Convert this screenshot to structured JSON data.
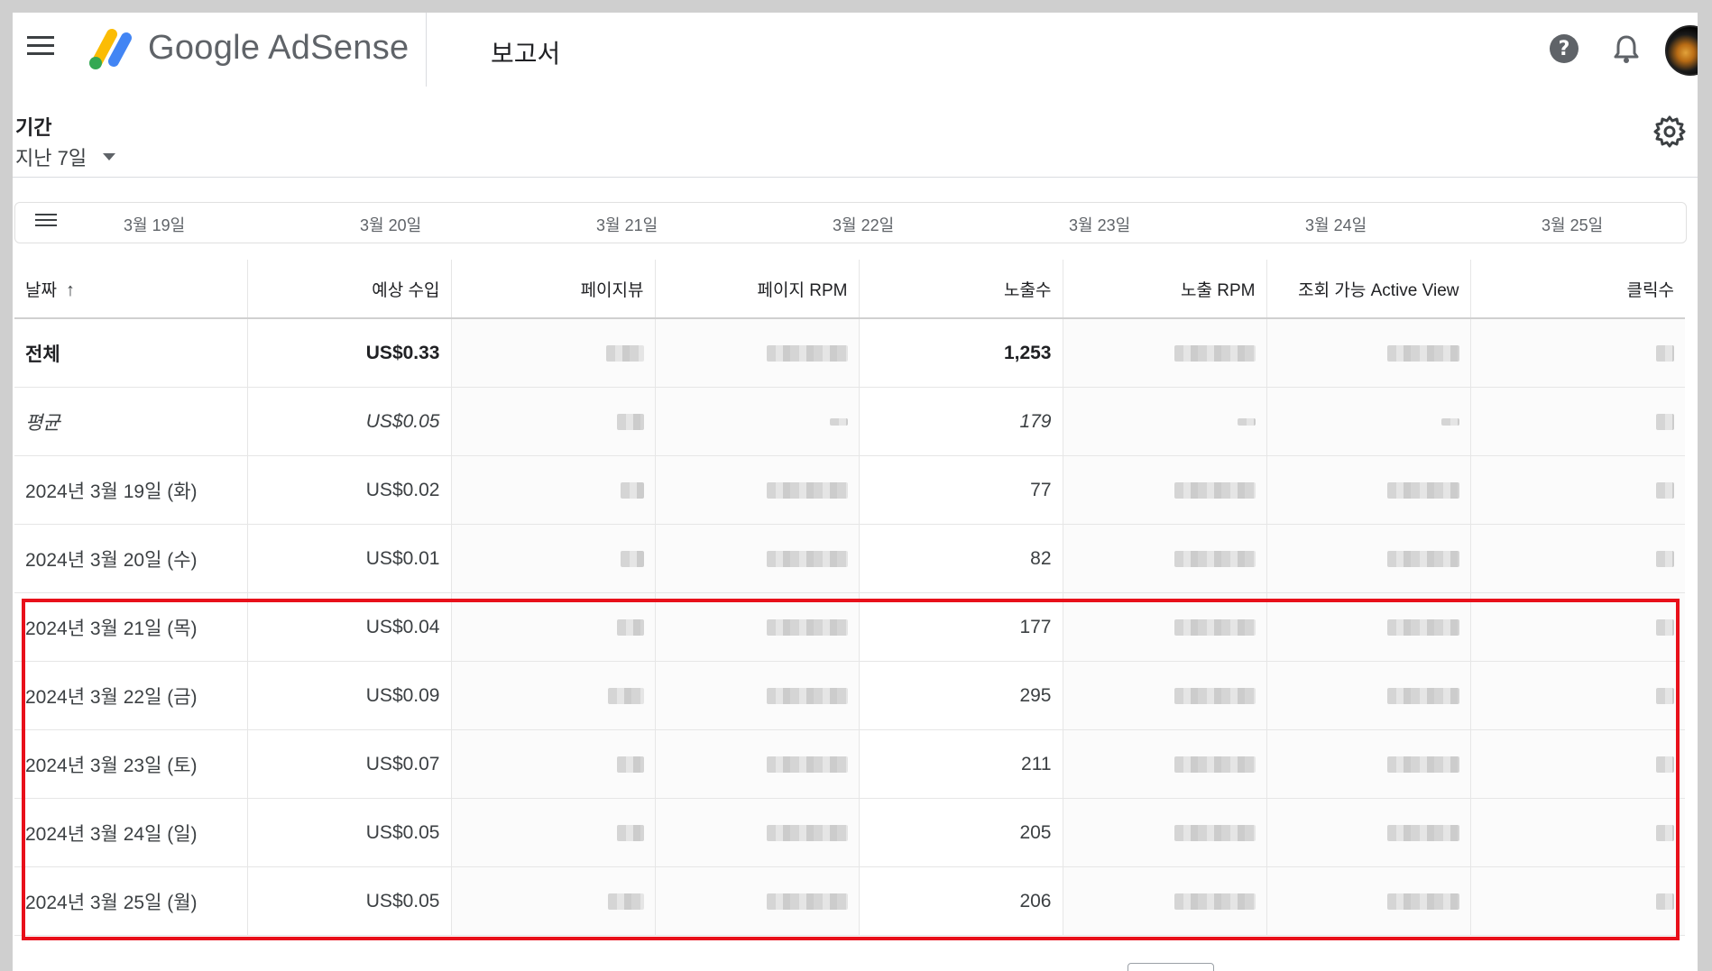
{
  "app": {
    "product_name": "Google AdSense",
    "page_title": "보고서"
  },
  "filter": {
    "period_label": "기간",
    "period_value": "지난 7일"
  },
  "timeline": {
    "dates": [
      "3월 19일",
      "3월 20일",
      "3월 21일",
      "3월 22일",
      "3월 23일",
      "3월 24일",
      "3월 25일"
    ]
  },
  "table": {
    "columns": [
      "날짜",
      "예상 수입",
      "페이지뷰",
      "페이지 RPM",
      "노출수",
      "노출 RPM",
      "조회 가능 Active View",
      "클릭수"
    ],
    "sort_indicator": "↑",
    "total": {
      "date": "전체",
      "earnings": "US$0.33",
      "impressions": "1,253"
    },
    "average": {
      "date": "평균",
      "earnings": "US$0.05",
      "impressions": "179"
    },
    "rows": [
      {
        "date": "2024년 3월 19일 (화)",
        "earnings": "US$0.02",
        "impressions": "77"
      },
      {
        "date": "2024년 3월 20일 (수)",
        "earnings": "US$0.01",
        "impressions": "82"
      },
      {
        "date": "2024년 3월 21일 (목)",
        "earnings": "US$0.04",
        "impressions": "177"
      },
      {
        "date": "2024년 3월 22일 (금)",
        "earnings": "US$0.09",
        "impressions": "295"
      },
      {
        "date": "2024년 3월 23일 (토)",
        "earnings": "US$0.07",
        "impressions": "211"
      },
      {
        "date": "2024년 3월 24일 (일)",
        "earnings": "US$0.05",
        "impressions": "205"
      },
      {
        "date": "2024년 3월 25일 (월)",
        "earnings": "US$0.05",
        "impressions": "206"
      }
    ]
  },
  "colors": {
    "highlight": "#e8101a",
    "logo_yellow": "#fbbc04",
    "logo_blue": "#4285f4",
    "logo_green": "#34a853"
  },
  "icons": [
    "menu-icon",
    "adsense-logo-icon",
    "help-icon",
    "bell-icon",
    "gear-icon",
    "list-icon"
  ]
}
